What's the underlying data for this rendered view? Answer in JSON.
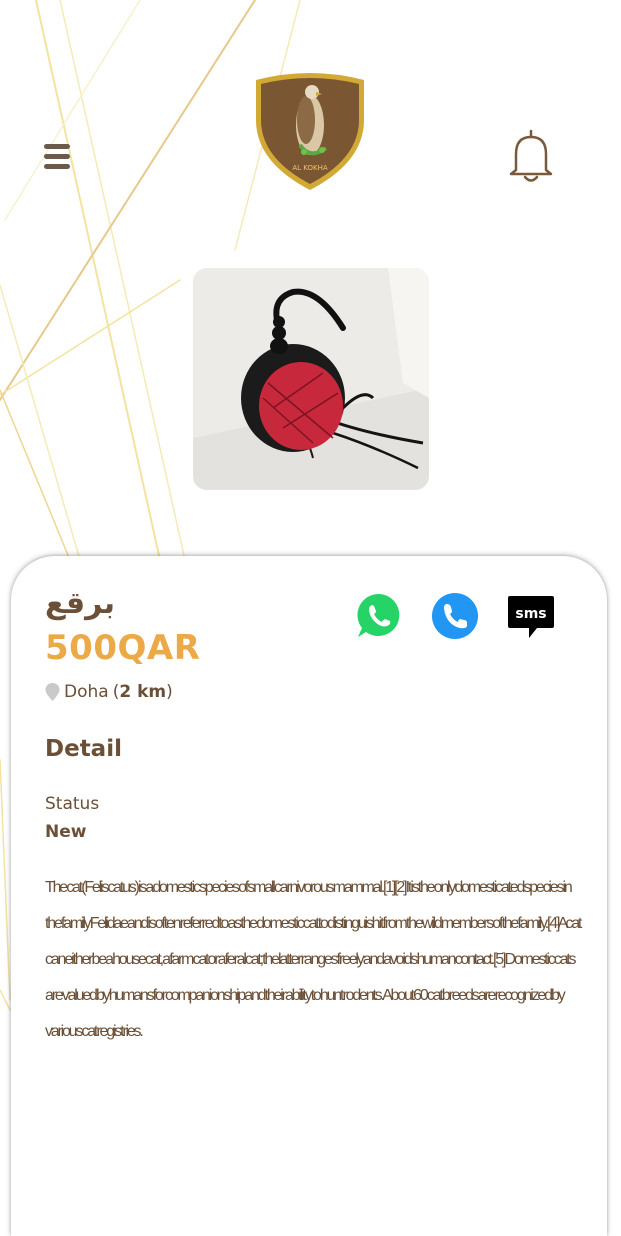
{
  "header": {
    "menu_icon": "hamburger-menu-icon",
    "logo_text": "AL KOKHA",
    "notification_icon": "bell-icon"
  },
  "product": {
    "title": "برقع",
    "price": "500QAR",
    "location_city": "Doha",
    "location_distance": "2 km"
  },
  "contact_actions": [
    {
      "name": "whatsapp",
      "icon": "whatsapp-icon",
      "color": "#25d366"
    },
    {
      "name": "phone",
      "icon": "phone-icon",
      "color": "#2196f3"
    },
    {
      "name": "sms",
      "icon": "sms-icon",
      "label": "sms",
      "color": "#000000"
    }
  ],
  "detail": {
    "section_title": "Detail",
    "status_label": "Status",
    "status_value": "New",
    "description": "The cat (Felis catus) is a domestic species of small carnivorous mammal.[1][2] It is the only domesticated species in the family Felidae and is often referred to as the domestic cat to distinguish it from the wild members of the family.[4] A cat can either be a house cat, a farm cat or a feral cat; the latter ranges freely and avoids human contact.[5] Domestic cats are valued by humans for companionship and their ability to hunt rodents. About 60 cat breeds are recognized by various cat registries."
  },
  "colors": {
    "brand_brown": "#6b4f36",
    "price_orange": "#eca947",
    "gold_line": "#e8d38a"
  }
}
